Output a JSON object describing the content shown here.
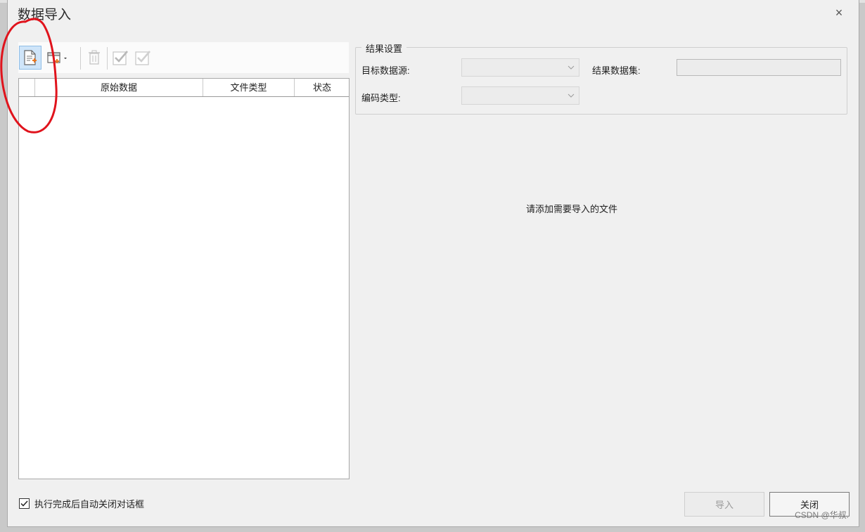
{
  "window": {
    "title": "数据导入",
    "close_glyph": "×"
  },
  "toolbar": {
    "buttons": [
      {
        "icon": "add-file-icon",
        "active": true,
        "enabled": true
      },
      {
        "icon": "add-folder-dropdown-icon",
        "enabled": true
      },
      {
        "icon": "delete-icon",
        "enabled": false
      },
      {
        "icon": "select-all-icon",
        "enabled": false
      },
      {
        "icon": "invert-select-icon",
        "enabled": false
      }
    ]
  },
  "grid": {
    "columns": [
      "",
      "原始数据",
      "文件类型",
      "状态"
    ],
    "rows": []
  },
  "result_settings": {
    "legend": "结果设置",
    "target_datasource_label": "目标数据源:",
    "target_datasource_value": "",
    "result_dataset_label": "结果数据集:",
    "result_dataset_value": "",
    "encoding_label": "编码类型:",
    "encoding_value": ""
  },
  "hint": "请添加需要导入的文件",
  "auto_close": {
    "label": "执行完成后自动关闭对话框",
    "checked": true
  },
  "buttons": {
    "import": "导入",
    "close": "关闭"
  },
  "watermark": "CSDN @华叔.",
  "colors": {
    "annotation_red": "#e0131c",
    "active_blue": "#cfe5f9",
    "icon_orange": "#e87722"
  }
}
